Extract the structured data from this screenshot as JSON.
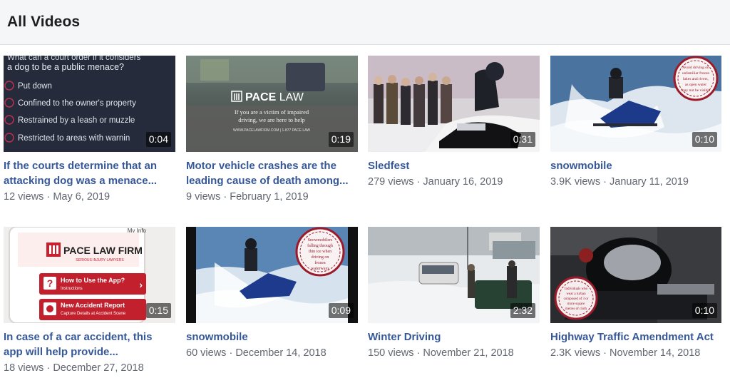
{
  "header": {
    "title": "All Videos"
  },
  "videos": [
    {
      "duration": "0:04",
      "title": "If the courts determine that an attacking dog was a menace...",
      "views": "12 views",
      "date": "May 6, 2019",
      "thumb_text": {
        "question": "What can a court order if it considers a dog to be a public menace?",
        "options": [
          "Put down",
          "Confined to the owner's property",
          "Restrained by a leash or muzzle",
          "Restricted to areas with warnin"
        ]
      }
    },
    {
      "duration": "0:19",
      "title": "Motor vehicle crashes are the leading cause of death among...",
      "views": "9 views",
      "date": "February 1, 2019",
      "thumb_text": {
        "brand": "PACE LAW",
        "tagline": "If you are a victim of impaired driving, we are here to help",
        "footer": "WWW.PACELAWFIRM.COM | 1-877 PACE LAW"
      }
    },
    {
      "duration": "0:31",
      "title": "Sledfest",
      "views": "279 views",
      "date": "January 16, 2019"
    },
    {
      "duration": "0:10",
      "title": "snowmobile",
      "views": "3.9K views",
      "date": "January 11, 2019",
      "thumb_text": {
        "badge": "Avoid driving on unfamiliar frozen lakes and rivers, as open water may not be visible"
      }
    },
    {
      "duration": "0:15",
      "title": "In case of a car accident, this app will help provide...",
      "views": "18 views",
      "date": "December 27, 2018",
      "thumb_text": {
        "tab": "My Info",
        "brand": "PACE LAW FIRM",
        "sub": "SERIOUS INJURY LAWYERS",
        "btn1": "How to Use the App?",
        "btn1_sub": "Instructions",
        "btn2": "New Accident Report",
        "btn2_sub": "Capture Details at Accident Scene"
      }
    },
    {
      "duration": "0:09",
      "title": "snowmobile",
      "views": "60 views",
      "date": "December 14, 2018",
      "thumb_text": {
        "badge": "Snowmobilers falling through thin ice when driving on frozen waterways"
      }
    },
    {
      "duration": "2:32",
      "title": "Winter Driving",
      "views": "150 views",
      "date": "November 21, 2018"
    },
    {
      "duration": "0:10",
      "title": "Highway Traffic Amendment Act",
      "views": "2.3K views",
      "date": "November 14, 2018",
      "thumb_text": {
        "badge": "Individuals who wear a turban composed of 3 or more square metres of cloth"
      }
    }
  ],
  "separator": " · ",
  "colors": {
    "link": "#365899",
    "meta": "#606770",
    "header_bg": "#f5f6f7",
    "badge_red": "#9b1b2a"
  }
}
